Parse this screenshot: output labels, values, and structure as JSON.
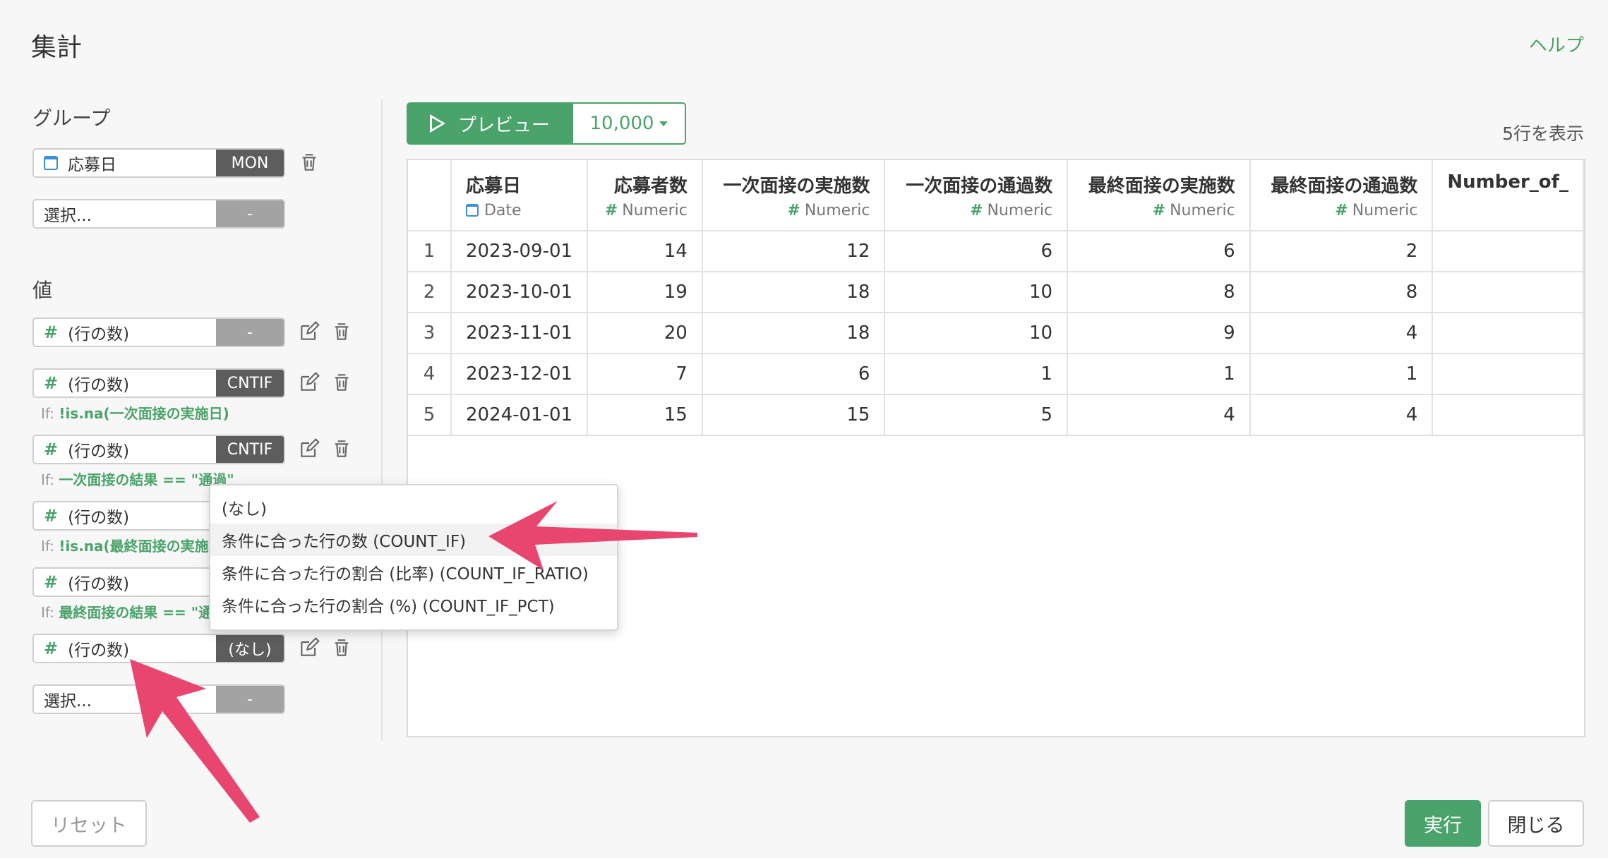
{
  "dialog": {
    "title": "集計",
    "help_label": "ヘルプ"
  },
  "group": {
    "label": "グループ",
    "fields": [
      {
        "name": "応募日",
        "func": "MON",
        "icon": "calendar-icon"
      },
      {
        "name": "選択...",
        "func": "-"
      }
    ]
  },
  "values": {
    "label": "値",
    "fields": [
      {
        "name": "(行の数)",
        "func": "-",
        "condition_prefix": "",
        "condition": ""
      },
      {
        "name": "(行の数)",
        "func": "CNTIF",
        "condition_prefix": "If: ",
        "condition": "!is.na(一次面接の実施日)"
      },
      {
        "name": "(行の数)",
        "func": "CNTIF",
        "condition_prefix": "If: ",
        "condition": "一次面接の結果 == \"通過\""
      },
      {
        "name": "(行の数)",
        "func": "",
        "condition_prefix": "If: ",
        "condition": "!is.na(最終面接の実施"
      },
      {
        "name": "(行の数)",
        "func": "",
        "condition_prefix": "If: ",
        "condition": "最終面接の結果 == \"通"
      },
      {
        "name": "(行の数)",
        "func": "(なし)",
        "condition_prefix": "",
        "condition": ""
      },
      {
        "name": "選択...",
        "func": "-",
        "condition_prefix": "",
        "condition": ""
      }
    ]
  },
  "dropdown": {
    "items": [
      "(なし)",
      "条件に合った行の数 (COUNT_IF)",
      "条件に合った行の割合 (比率) (COUNT_IF_RATIO)",
      "条件に合った行の割合 (%) (COUNT_IF_PCT)"
    ]
  },
  "preview": {
    "label": "プレビュー",
    "count": "10,000",
    "row_count_text": "5行を表示"
  },
  "table": {
    "columns": [
      {
        "name": "応募日",
        "type": "Date",
        "icon": "calendar-icon"
      },
      {
        "name": "応募者数",
        "type": "Numeric",
        "icon": "#"
      },
      {
        "name": "一次面接の実施数",
        "type": "Numeric",
        "icon": "#"
      },
      {
        "name": "一次面接の通過数",
        "type": "Numeric",
        "icon": "#"
      },
      {
        "name": "最終面接の実施数",
        "type": "Numeric",
        "icon": "#"
      },
      {
        "name": "最終面接の通過数",
        "type": "Numeric",
        "icon": "#"
      },
      {
        "name": "Number_of_",
        "type": "",
        "icon": ""
      }
    ],
    "rows": [
      [
        "1",
        "2023-09-01",
        "14",
        "12",
        "6",
        "6",
        "2",
        ""
      ],
      [
        "2",
        "2023-10-01",
        "19",
        "18",
        "10",
        "8",
        "8",
        ""
      ],
      [
        "3",
        "2023-11-01",
        "20",
        "18",
        "10",
        "9",
        "4",
        ""
      ],
      [
        "4",
        "2023-12-01",
        "7",
        "6",
        "1",
        "1",
        "1",
        ""
      ],
      [
        "5",
        "2024-01-01",
        "15",
        "15",
        "5",
        "4",
        "4",
        ""
      ]
    ]
  },
  "footer": {
    "reset_label": "リセット",
    "run_label": "実行",
    "close_label": "閉じる"
  },
  "colors": {
    "accent": "#4aa36a",
    "arrow": "#e8456f",
    "func_dark": "#5d5d5d",
    "func_light": "#a3a3a3"
  }
}
